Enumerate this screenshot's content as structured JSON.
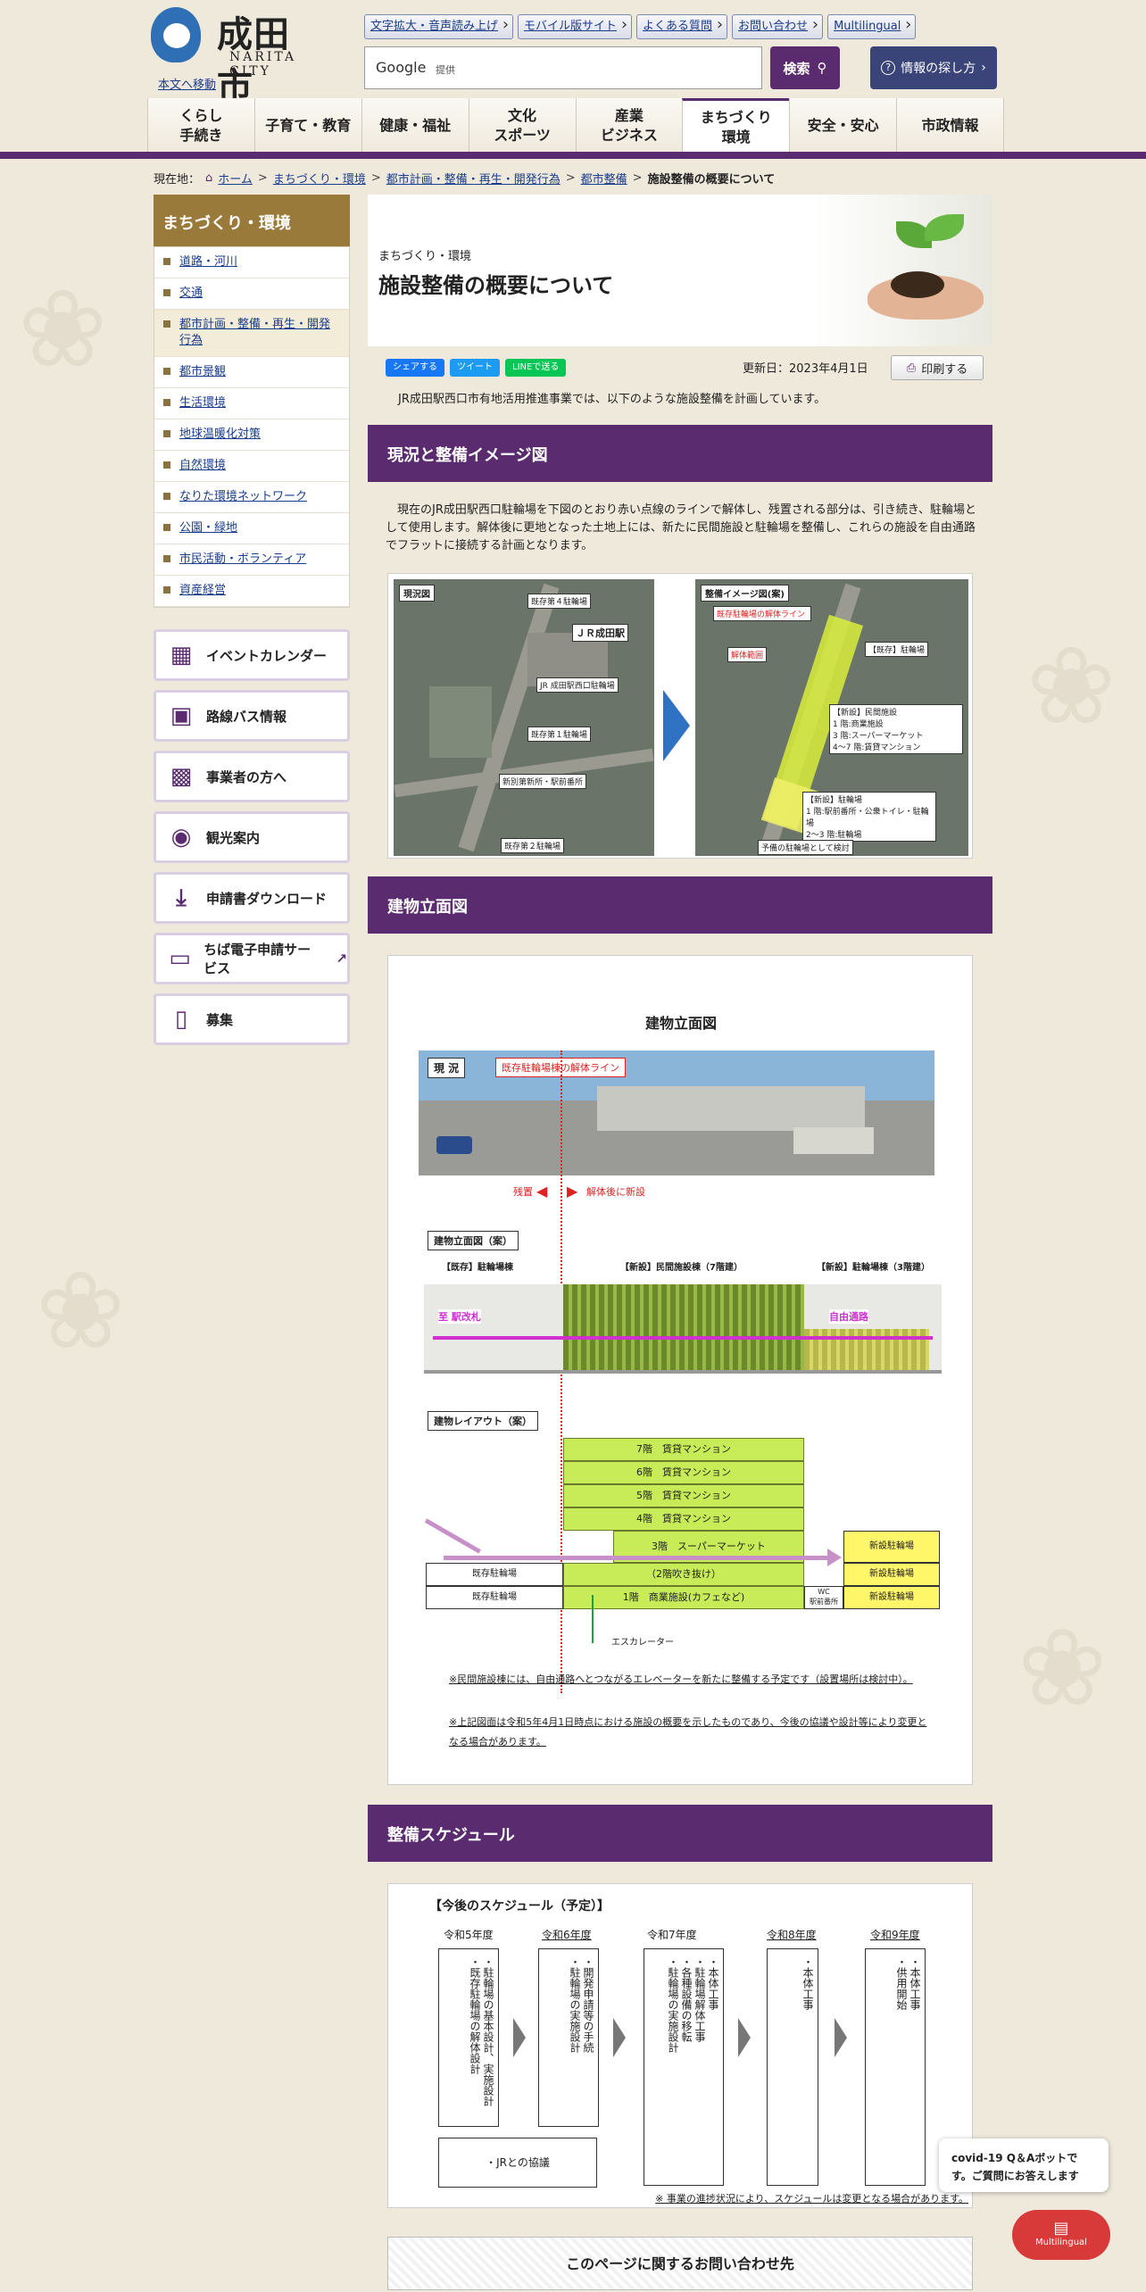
{
  "site": {
    "name": "成田市",
    "name_en": "NARITA CITY",
    "skip_link": "本文へ移動"
  },
  "top_links": [
    "文字拡大・音声読み上げ",
    "モバイル版サイト",
    "よくある質問",
    "お問い合わせ",
    "Multilingual"
  ],
  "search": {
    "provider": "Google",
    "provider_note": "提供",
    "button": "検索",
    "how_button": "情報の探し方"
  },
  "gnav": [
    "くらし\n手続き",
    "子育て・教育",
    "健康・福祉",
    "文化\nスポーツ",
    "産業\nビジネス",
    "まちづくり\n環境",
    "安全・安心",
    "市政情報"
  ],
  "breadcrumb": {
    "prefix": "現在地：",
    "items": [
      "ホーム",
      "まちづくり・環境",
      "都市計画・整備・再生・開発行為",
      "都市整備"
    ],
    "current": "施設整備の概要について"
  },
  "sidebar": {
    "title": "まちづくり・環境",
    "items": [
      "道路・河川",
      "交通",
      "都市計画・整備・再生・開発行為",
      "都市景観",
      "生活環境",
      "地球温暖化対策",
      "自然環境",
      "なりた環境ネットワーク",
      "公園・緑地",
      "市民活動・ボランティア",
      "資産経営"
    ],
    "banners": [
      {
        "label": "イベントカレンダー",
        "icon": "calendar-icon"
      },
      {
        "label": "路線バス情報",
        "icon": "bus-icon"
      },
      {
        "label": "事業者の方へ",
        "icon": "building-icon"
      },
      {
        "label": "観光案内",
        "icon": "camera-icon"
      },
      {
        "label": "申請書ダウンロード",
        "icon": "download-icon"
      },
      {
        "label": "ちば電子申請サービス",
        "icon": "computer-icon"
      },
      {
        "label": "募集",
        "icon": "clipboard-icon"
      }
    ]
  },
  "page": {
    "category": "まちづくり・環境",
    "title": "施設整備の概要について",
    "share": {
      "facebook": "シェアする",
      "twitter": "ツイート",
      "line": "LINEで送る"
    },
    "updated": "更新日：2023年4月1日",
    "print": "印刷する",
    "intro": "JR成田駅西口市有地活用推進事業では、以下のような施設整備を計画しています。"
  },
  "section1": {
    "heading": "現況と整備イメージ図",
    "text": "現在のJR成田駅西口駐輪場を下図のとおり赤い点線のラインで解体し、残置される部分は、引き続き、駐輪場として使用します。解体後に更地となった土地上には、新たに民間施設と駐輪場を整備し、これらの施設を自由通路でフラットに接続する計画となります。",
    "left_tag": "現況図",
    "right_tag": "整備イメージ図(案)",
    "left_labels": [
      "既存第４駐輪場",
      "ＪＲ成田駅",
      "JR 成田駅西口駐輪場",
      "既存第１駐輪場",
      "新別第新所・駅前番所",
      "既存第２駐輪場"
    ],
    "right_labels": [
      "既存駐輪場の解体ライン",
      "解体範囲",
      "【既存】駐輪場",
      "【新設】民間施設",
      "1 階:商業施設",
      "3 階:スーパーマーケット",
      "4〜7 階:賃貸マンション",
      "【新設】駐輪場",
      "1 階:駅前番所・公衆トイレ・駐輪場",
      "2〜3 階:駐輪場",
      "予備の駐輪場として検討"
    ]
  },
  "section2": {
    "heading": "建物立面図",
    "diagram_title": "建物立面図",
    "photo_tag": "現 況",
    "demolish_line": "既存駐輪場棟の解体ライン",
    "keep": "残置",
    "after": "解体後に新設",
    "elev_tag": "建物立面図（案）",
    "elev_header": [
      "【既存】駐輪場棟",
      "【新設】民間施設棟（7階建）",
      "【新設】駐輪場棟（3階建）"
    ],
    "to_gate": "至 駅改札",
    "free_passage": "自由通路",
    "layout_tag": "建物レイアウト（案）",
    "floors": [
      "7階　賃貸マンション",
      "6階　賃貸マンション",
      "5階　賃貸マンション",
      "4階　賃貸マンション",
      "3階　スーパーマーケット",
      "（2階吹き抜け）",
      "1階　商業施設(カフェなど)"
    ],
    "right_floors": [
      "新設駐輪場",
      "新設駐輪場",
      "新設駐輪場"
    ],
    "left_floors": [
      "既存駐輪場",
      "既存駐輪場"
    ],
    "wc": "WC\n駅前番所",
    "escalator": "エスカレーター",
    "notes": [
      "※民間施設棟には、自由通路へとつながるエレベーターを新たに整備する予定です（設置場所は検討中）。",
      "※上記図面は令和5年4月1日時点における施設の概要を示したものであり、今後の協議や設計等により変更となる場合があります。"
    ]
  },
  "section3": {
    "heading": "整備スケジュール",
    "title": "【今後のスケジュール（予定）】",
    "years": [
      "令和5年度",
      "令和6年度",
      "令和7年度",
      "令和8年度",
      "令和9年度"
    ],
    "steps": [
      "・駐輪場の基本設計、実施設計\n・既存駐輪場の解体設計",
      "・開発申請等の手続\n・駐輪場の実施設計",
      "・本体工事\n・駐輪場解体工事\n・各種設備の移転\n・駐輪場の実施設計",
      "・本体工事",
      "・本体工事\n・供用開始"
    ],
    "jr": "・JRとの協議",
    "note": "※ 事業の進捗状況により、スケジュールは変更となる場合があります。"
  },
  "inquiry": {
    "heading": "このページに関するお問い合わせ先"
  },
  "chat": {
    "bubble": "covid-19 Q＆Aボットです。ご質問にお答えします",
    "button": "Multilingual"
  }
}
